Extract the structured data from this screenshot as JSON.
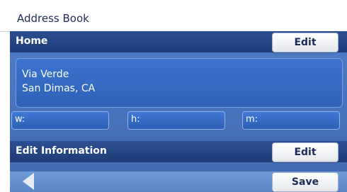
{
  "title": "Address Book",
  "home": {
    "label": "Home",
    "edit_label": "Edit"
  },
  "address": {
    "line1": "Via Verde",
    "line2": "San Dimas, CA"
  },
  "phones": {
    "w": "w:",
    "h": "h:",
    "m": "m:"
  },
  "edit_info": {
    "label": "Edit Information",
    "edit_label": "Edit"
  },
  "footer": {
    "save_label": "Save",
    "back_icon": "back-arrow-icon"
  }
}
